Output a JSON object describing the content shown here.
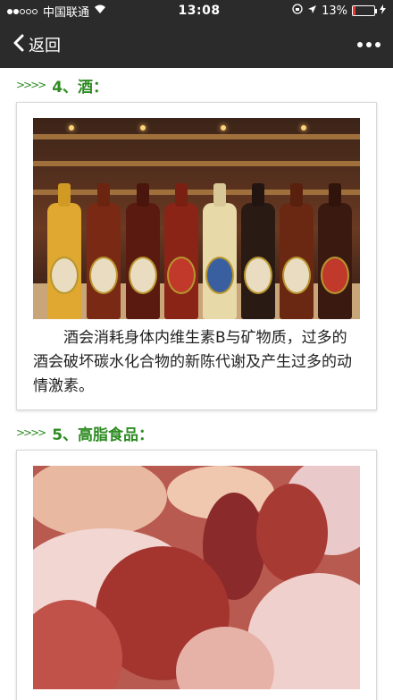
{
  "status_bar": {
    "carrier": "中国联通",
    "time": "13:08",
    "battery_percent": "13%",
    "battery_level": 0.13,
    "battery_color": "#e53935"
  },
  "nav": {
    "back_label": "返回",
    "back_icon": "chevron-left-icon",
    "more_icon": "more-dots-icon"
  },
  "sections": [
    {
      "arrows": ">>>>",
      "title": "4、酒：",
      "image_alt_icon": "beer-bottles-photo",
      "caption": "酒会消耗身体内维生素B与矿物质，过多的酒会破坏碳水化合物的新陈代谢及产生过多的动情激素。"
    },
    {
      "arrows": ">>>>",
      "title": "5、高脂食品：",
      "image_alt_icon": "meat-platter-photo"
    }
  ],
  "colors": {
    "bar_background": "#2b2b2b",
    "title_green": "#2e8b22"
  }
}
